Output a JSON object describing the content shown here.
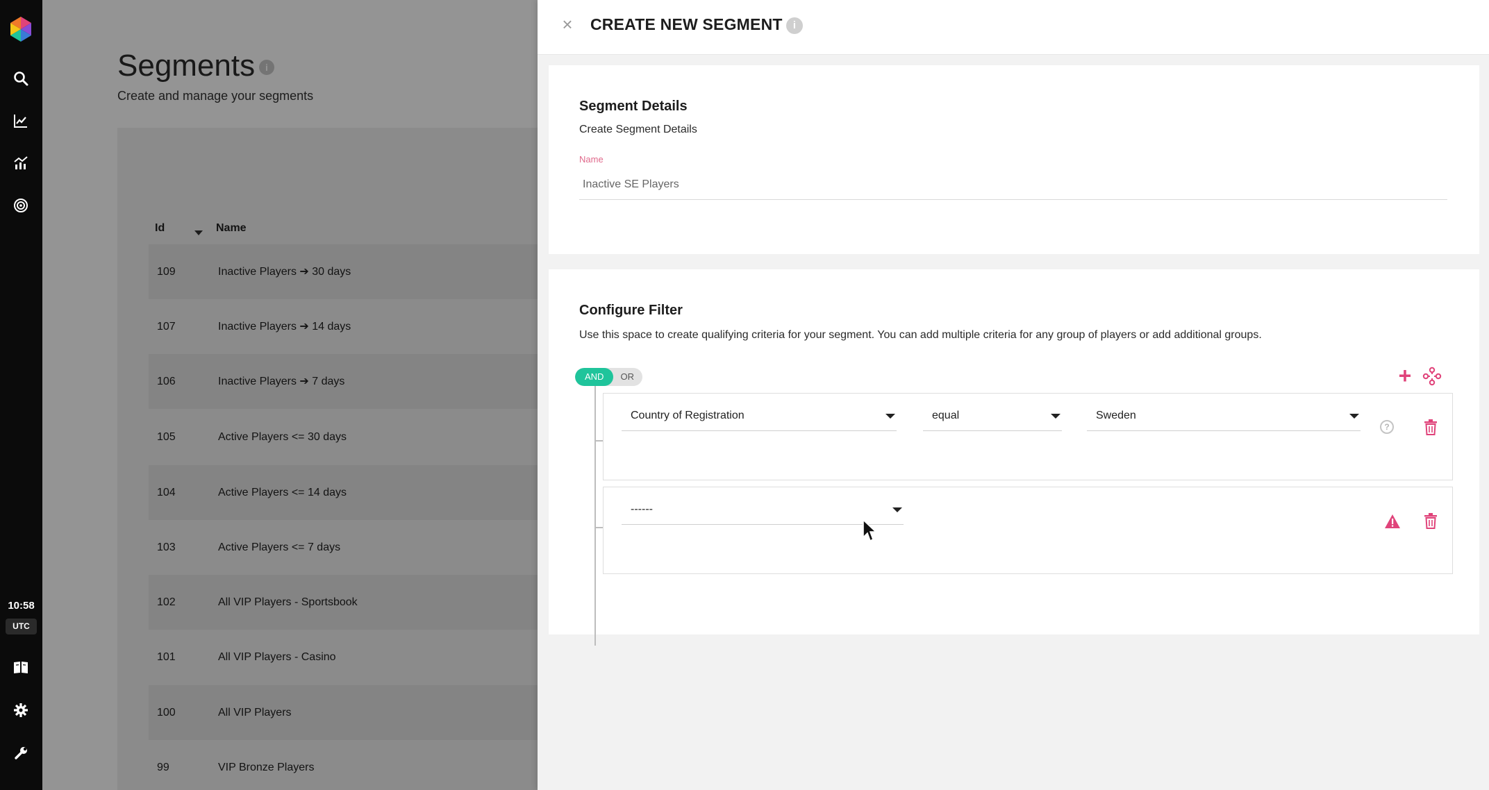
{
  "rail": {
    "time": "10:58",
    "timezone": "UTC",
    "icons": [
      "logo-icon",
      "search-icon",
      "line-chart-icon",
      "analytics-icon",
      "target-icon",
      "book-icon",
      "gear-icon",
      "wrench-icon"
    ]
  },
  "background_page": {
    "title": "Segments",
    "subtitle": "Create and manage your segments",
    "table": {
      "headers": [
        "Id",
        "Name"
      ],
      "rows": [
        {
          "id": "109",
          "name": "Inactive Players ➔ 30 days"
        },
        {
          "id": "107",
          "name": "Inactive Players ➔ 14 days"
        },
        {
          "id": "106",
          "name": "Inactive Players ➔ 7 days"
        },
        {
          "id": "105",
          "name": "Active Players <= 30 days"
        },
        {
          "id": "104",
          "name": "Active Players <= 14 days"
        },
        {
          "id": "103",
          "name": "Active Players <= 7 days"
        },
        {
          "id": "102",
          "name": "All VIP Players - Sportsbook"
        },
        {
          "id": "101",
          "name": "All VIP Players - Casino"
        },
        {
          "id": "100",
          "name": "All VIP Players"
        },
        {
          "id": "99",
          "name": "VIP Bronze Players"
        }
      ]
    }
  },
  "drawer": {
    "title": "CREATE NEW SEGMENT",
    "close_label": "×",
    "details": {
      "heading": "Segment Details",
      "subheading": "Create Segment Details",
      "name_label": "Name",
      "name_value": "Inactive SE Players"
    },
    "filter": {
      "heading": "Configure Filter",
      "description": "Use this space to create qualifying criteria for your segment. You can add multiple criteria for any group of players or add additional groups.",
      "and_label": "AND",
      "or_label": "OR",
      "add_label": "+",
      "criteria": [
        {
          "field": "Country of Registration",
          "operator": "equal",
          "value": "Sweden"
        },
        {
          "field": "------"
        }
      ]
    }
  },
  "colors": {
    "accent_pink": "#e0437a",
    "toggle_green": "#1fc49b",
    "label_pink": "#e06a8c"
  }
}
